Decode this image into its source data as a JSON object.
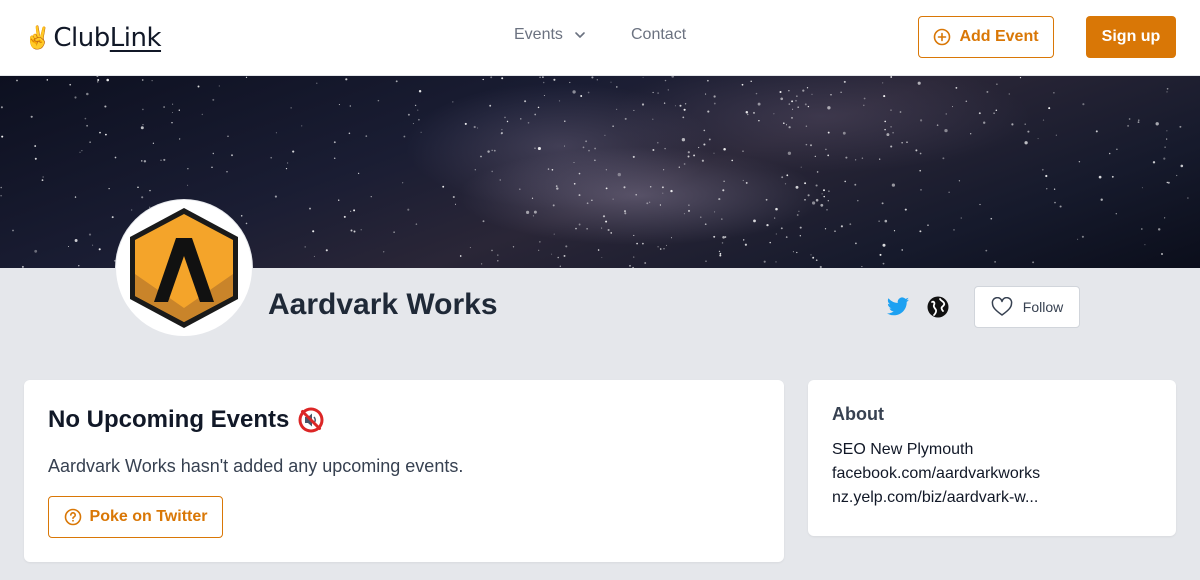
{
  "nav": {
    "logo_emoji": "✌️",
    "logo_text_a": "Club",
    "logo_text_b": "Link",
    "events_label": "Events",
    "contact_label": "Contact",
    "add_event_label": "Add Event",
    "signup_label": "Sign up"
  },
  "club": {
    "name": "Aardvark Works",
    "follow_label": "Follow"
  },
  "events": {
    "title": "No Upcoming Events",
    "message": "Aardvark Works hasn't added any upcoming events.",
    "poke_label": "Poke on Twitter"
  },
  "about": {
    "title": "About",
    "links": [
      "SEO New Plymouth",
      "facebook.com/aardvarkworks",
      "nz.yelp.com/biz/aardvark-w..."
    ]
  },
  "colors": {
    "accent": "#d97706",
    "twitter": "#1da1f2",
    "background": "#e5e7eb"
  }
}
